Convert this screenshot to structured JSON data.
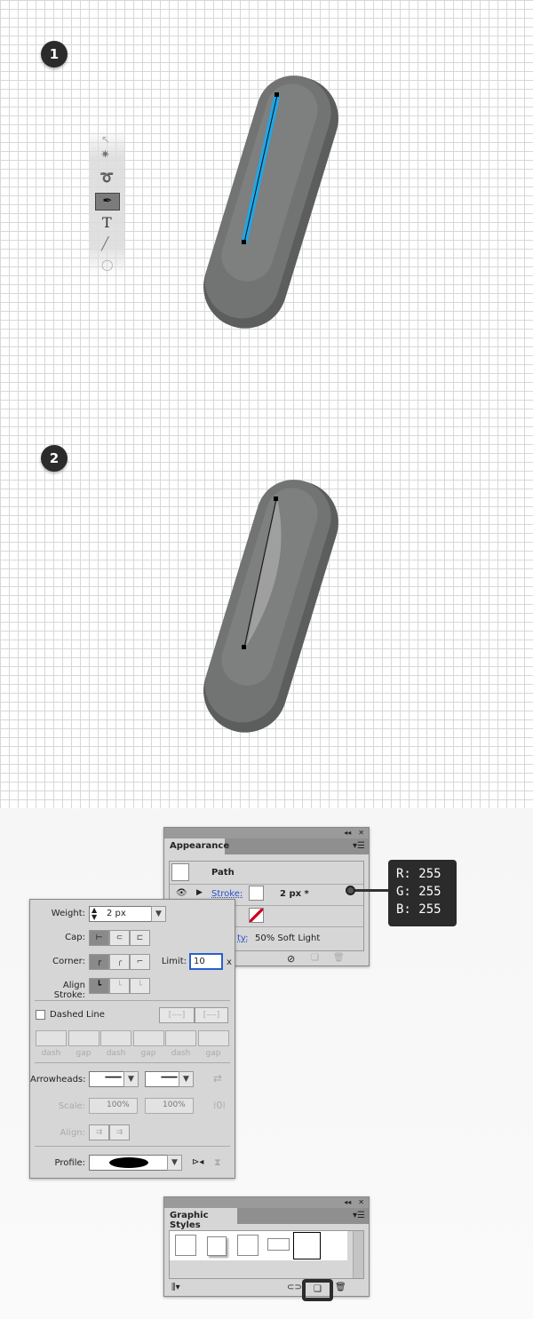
{
  "steps": [
    "1",
    "2"
  ],
  "colors": {
    "accent": "#1ea7e8",
    "capsule": "#6e6f6f",
    "badge": "#2b2b2b"
  },
  "toolbar": {
    "tools": [
      "direct-selection-icon",
      "magic-wand-icon",
      "lasso-icon",
      "pen-icon",
      "type-icon",
      "line-icon",
      "ellipse-icon"
    ],
    "active": "pen-icon",
    "type_glyph": "T"
  },
  "appearance": {
    "title": "Appearance",
    "path_label": "Path",
    "stroke_label": "Stroke:",
    "stroke_value": "2 px *",
    "opacity_label": "ty:",
    "opacity_value": "50% Soft Light"
  },
  "color_badge": {
    "r": "R: 255",
    "g": "G: 255",
    "b": "B: 255"
  },
  "stroke_panel": {
    "weight_label": "Weight:",
    "weight_value": "2 px",
    "cap_label": "Cap:",
    "corner_label": "Corner:",
    "limit_label": "Limit:",
    "limit_value": "10",
    "limit_unit": "x",
    "align_label": "Align Stroke:",
    "dashed_label": "Dashed Line",
    "dash_labels": [
      "dash",
      "gap",
      "dash",
      "gap",
      "dash",
      "gap"
    ],
    "arrowheads_label": "Arrowheads:",
    "scale_label": "Scale:",
    "scale1": "100%",
    "scale2": "100%",
    "align2_label": "Align:",
    "profile_label": "Profile:"
  },
  "graphic_styles": {
    "title": "Graphic Styles"
  }
}
